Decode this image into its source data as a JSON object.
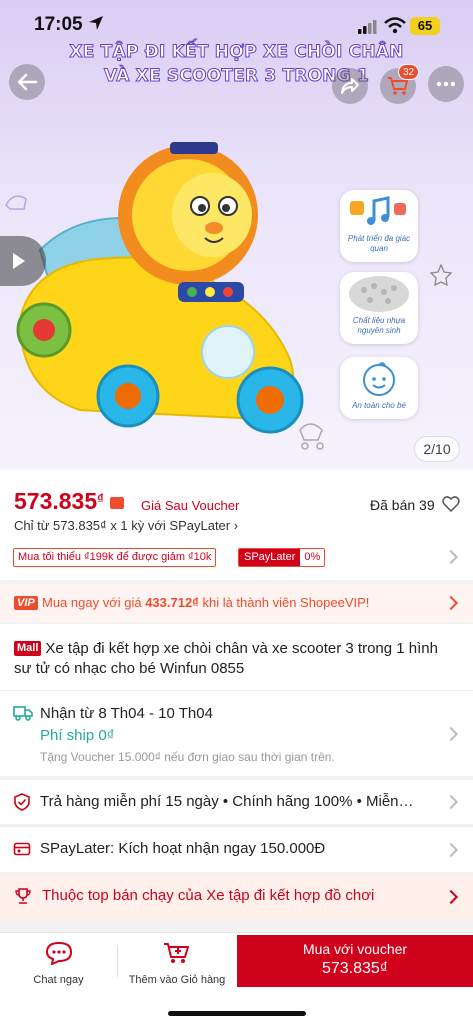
{
  "status_bar": {
    "time": "17:05",
    "battery": "65"
  },
  "hero": {
    "title_line1": "XE TẬP ĐI KẾT HỢP XE CHÒI CHÂN",
    "title_line2": "VÀ XE SCOOTER 3 TRONG 1",
    "cart_count": "32",
    "features": [
      {
        "label": "Phát triển đa giác quan",
        "icon": "music-notes-icon"
      },
      {
        "label": "Chất liệu nhựa nguyên sinh",
        "icon": "plastic-pellets-icon"
      },
      {
        "label": "An toàn cho bé",
        "icon": "baby-face-icon"
      }
    ],
    "image_counter": "2/10"
  },
  "price": {
    "amount": "573.835",
    "currency": "₫",
    "note": "Giá Sau Voucher",
    "sold": "Đã bán 39",
    "spaylater_line": "Chỉ từ 573.835₫ x 1 kỳ với SPayLater ›",
    "promo": "Mua tối thiểu ₫199k để được giảm ₫10k",
    "spaylater_tag": "SPayLater",
    "spaylater_rate": "0%"
  },
  "vip": {
    "badge": "VIP",
    "text_prefix": "Mua ngay với giá ",
    "text_price": "433.712₫",
    "text_suffix": " khi là thành viên ShopeeVIP!"
  },
  "product": {
    "mall_badge": "Mall",
    "title": "Xe tập đi kết hợp xe chòi chân và xe scooter 3 trong 1 hình sư tử có nhạc cho bé Winfun 0855"
  },
  "shipping": {
    "delivery": "Nhận từ 8 Th04 - 10 Th04",
    "fee": "Phí ship 0₫",
    "voucher": "Tặng Voucher 15.000₫ nếu đơn giao sau thời gian trên."
  },
  "guarantee": {
    "text": "Trả hàng miễn phí 15 ngày  •  Chính hãng 100%  •  Miễn…"
  },
  "spaylater_row": {
    "text": "SPayLater: Kích hoạt nhận ngay 150.000Đ"
  },
  "top_seller": {
    "text": "Thuộc top bán chạy của Xe tập đi kết hợp đồ chơi"
  },
  "bottom_bar": {
    "chat_label": "Chat ngay",
    "cart_label": "Thêm vào Giỏ hàng",
    "buy_line1": "Mua với voucher",
    "buy_line2": "573.835₫"
  },
  "colors": {
    "accent": "#d0011b",
    "shopee_orange": "#ee4d2d",
    "teal": "#26aa99",
    "hero_purple": "#d9cdf3"
  }
}
